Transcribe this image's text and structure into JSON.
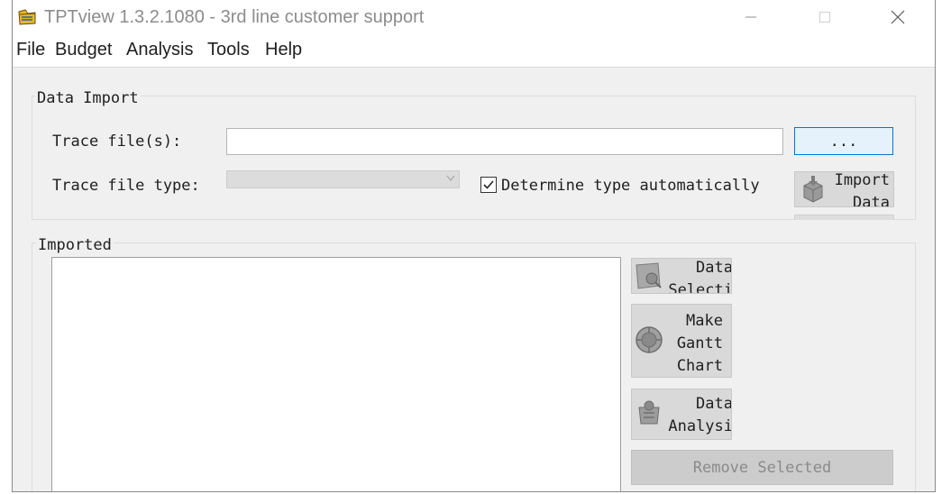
{
  "window": {
    "title": "TPTview 1.3.2.1080 - 3rd line customer support",
    "controls": {
      "minimize": "minimize-icon",
      "maximize": "maximize-icon",
      "close": "close-icon"
    }
  },
  "menu": [
    "File",
    "Budget",
    "Analysis",
    "Tools",
    "Help"
  ],
  "data_import": {
    "group_title": "Data Import",
    "trace_files_label": "Trace file(s):",
    "trace_files_value": "",
    "browse_label": "...",
    "trace_type_label": "Trace file type:",
    "trace_type_value": "",
    "auto_type_label": "Determine type automatically",
    "auto_type_checked": true,
    "import_button_label": "Import\nData"
  },
  "imported": {
    "group_title": "Imported",
    "items": [],
    "buttons": {
      "data_selection": "Data\nSelecti",
      "gantt": "Make\nGantt\nChart",
      "analysis": "Data\nAnalysi"
    },
    "remove_selected_label": "Remove Selected"
  }
}
